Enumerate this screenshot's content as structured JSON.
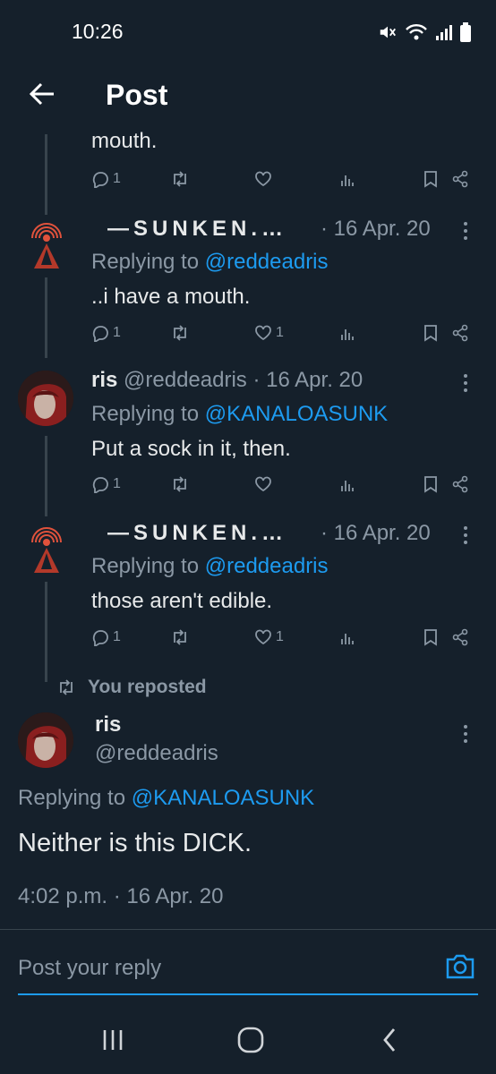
{
  "status_bar": {
    "time": "10:26"
  },
  "header": {
    "title": "Post"
  },
  "tweets": [
    {
      "text": "mouth.",
      "replies": "1",
      "likes": ""
    },
    {
      "name": "—SUNKEN.…",
      "meta": "· 16 Apr. 20",
      "replying_prefix": "Replying to ",
      "replying_handle": "@reddeadris",
      "text": "..i have a mouth.",
      "replies": "1",
      "likes": "1"
    },
    {
      "name": "ris",
      "handle": "@reddeadris",
      "meta": "· 16 Apr. 20",
      "replying_prefix": "Replying to ",
      "replying_handle": "@KANALOASUNK",
      "text": "Put a sock in it, then.",
      "replies": "1",
      "likes": ""
    },
    {
      "name": "—SUNKEN.…",
      "meta": "· 16 Apr. 20",
      "replying_prefix": "Replying to ",
      "replying_handle": "@reddeadris",
      "text": "those aren't edible.",
      "replies": "1",
      "likes": "1"
    }
  ],
  "focused": {
    "repost_label": "You reposted",
    "name": "ris",
    "handle": "@reddeadris",
    "replying_prefix": "Replying to ",
    "replying_handle": "@KANALOASUNK",
    "text": "Neither is this DICK.",
    "timestamp": "4:02 p.m. · 16 Apr. 20"
  },
  "reply_bar": {
    "placeholder": "Post your reply"
  },
  "colors": {
    "background": "#15202b",
    "accent": "#1d9bf0",
    "muted": "#8b98a5"
  }
}
